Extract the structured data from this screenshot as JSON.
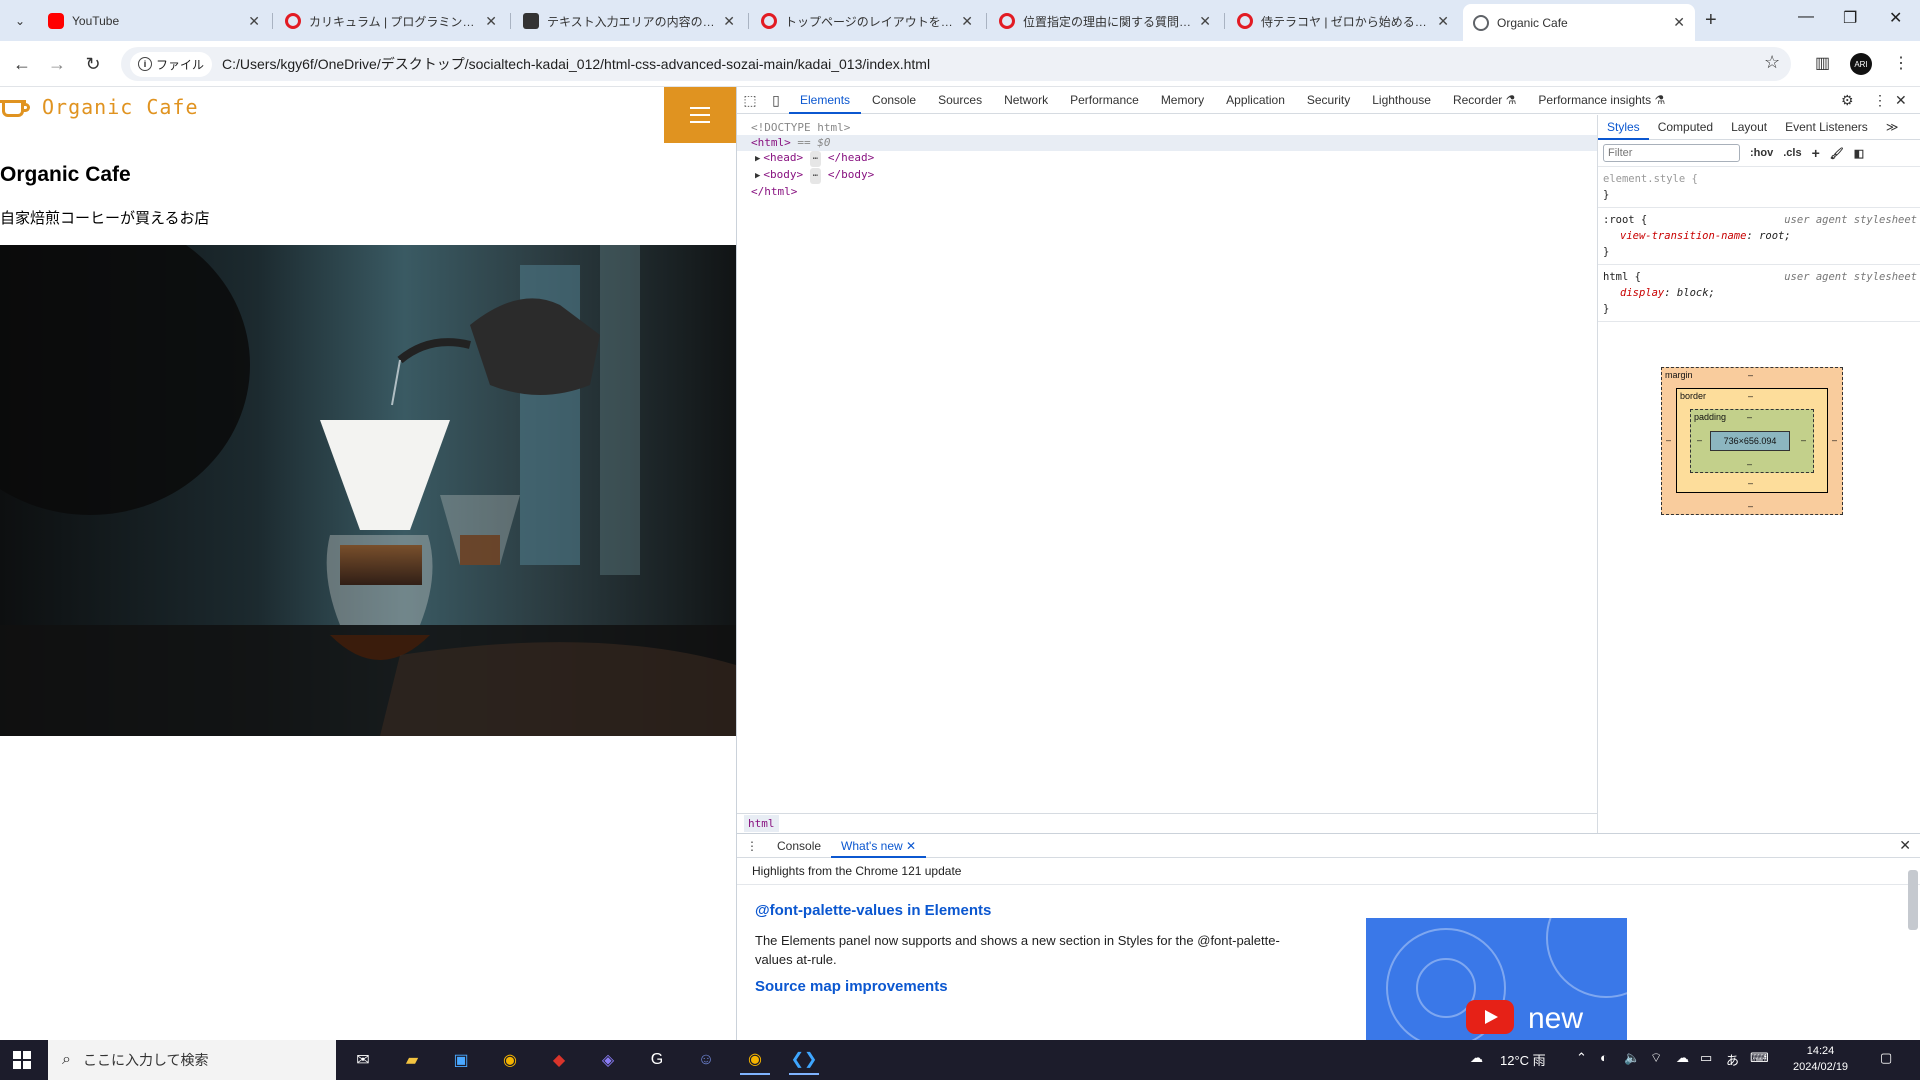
{
  "browser": {
    "tabs": [
      {
        "title": "YouTube",
        "favicon_color": "#ff0000"
      },
      {
        "title": "カリキュラム | プログラミング学習サイ",
        "favicon_color": "#e21b23"
      },
      {
        "title": "テキスト入力エリアの内容の結果の",
        "favicon_color": "#333333"
      },
      {
        "title": "トップページのレイアウトをスマートフォ",
        "favicon_color": "#e21b23"
      },
      {
        "title": "位置指定の理由に関する質問 | プ",
        "favicon_color": "#e21b23"
      },
      {
        "title": "侍テラコヤ | ゼロから始める定額・学",
        "favicon_color": "#e21b23"
      },
      {
        "title": "Organic Cafe",
        "favicon_color": "#5f6368",
        "active": true
      }
    ],
    "omnibox": {
      "chip_label": "ファイル",
      "url": "C:/Users/kgy6f/OneDrive/デスクトップ/socialtech-kadai_012/html-css-advanced-sozai-main/kadai_013/index.html"
    },
    "profile_initials": "ARI"
  },
  "page": {
    "logo_text": "Organic Cafe",
    "title": "Organic Cafe",
    "subtitle": "自家焙煎コーヒーが買えるお店",
    "accent_color": "#e09320"
  },
  "devtools": {
    "tabs": [
      "Elements",
      "Console",
      "Sources",
      "Network",
      "Performance",
      "Memory",
      "Application",
      "Security",
      "Lighthouse",
      "Recorder ⚗",
      "Performance insights ⚗"
    ],
    "active_tab": "Elements",
    "dom": {
      "doctype": "<!DOCTYPE html>",
      "html_open": "<html>",
      "html_marker": "== $0",
      "head": "<head>",
      "head_close": "</head>",
      "body": "<body>",
      "body_close": "</body>",
      "html_close": "</html>",
      "ellipsis": "⋯"
    },
    "breadcrumb": "html",
    "styles": {
      "tabs": [
        "Styles",
        "Computed",
        "Layout",
        "Event Listeners"
      ],
      "more": "≫",
      "filter_placeholder": "Filter",
      "hov": ":hov",
      "cls": ".cls",
      "rules": [
        {
          "selector": "element.style {",
          "origin": "",
          "props": [],
          "close": "}"
        },
        {
          "selector": ":root {",
          "origin": "user agent stylesheet",
          "props": [
            {
              "name": "view-transition-name",
              "value": "root;"
            }
          ],
          "close": "}"
        },
        {
          "selector": "html {",
          "origin": "user agent stylesheet",
          "props": [
            {
              "name": "display",
              "value": "block;"
            }
          ],
          "close": "}"
        }
      ],
      "box_model": {
        "margin_label": "margin",
        "border_label": "border",
        "padding_label": "padding",
        "content": "736×656.094",
        "dash": "–"
      }
    },
    "drawer": {
      "tabs": [
        "Console",
        "What's new"
      ],
      "active": "What's new",
      "highlight": "Highlights from the Chrome 121 update",
      "sections": [
        {
          "heading": "@font-palette-values in Elements",
          "body": "The Elements panel now supports and shows a new section in Styles for the @font-palette-values at-rule."
        },
        {
          "heading": "Source map improvements",
          "body": ""
        }
      ],
      "promo_text": "new"
    }
  },
  "taskbar": {
    "search_placeholder": "ここに入力して検索",
    "weather": "12°C 雨",
    "ime": "あ",
    "time": "14:24",
    "date": "2024/02/19"
  }
}
